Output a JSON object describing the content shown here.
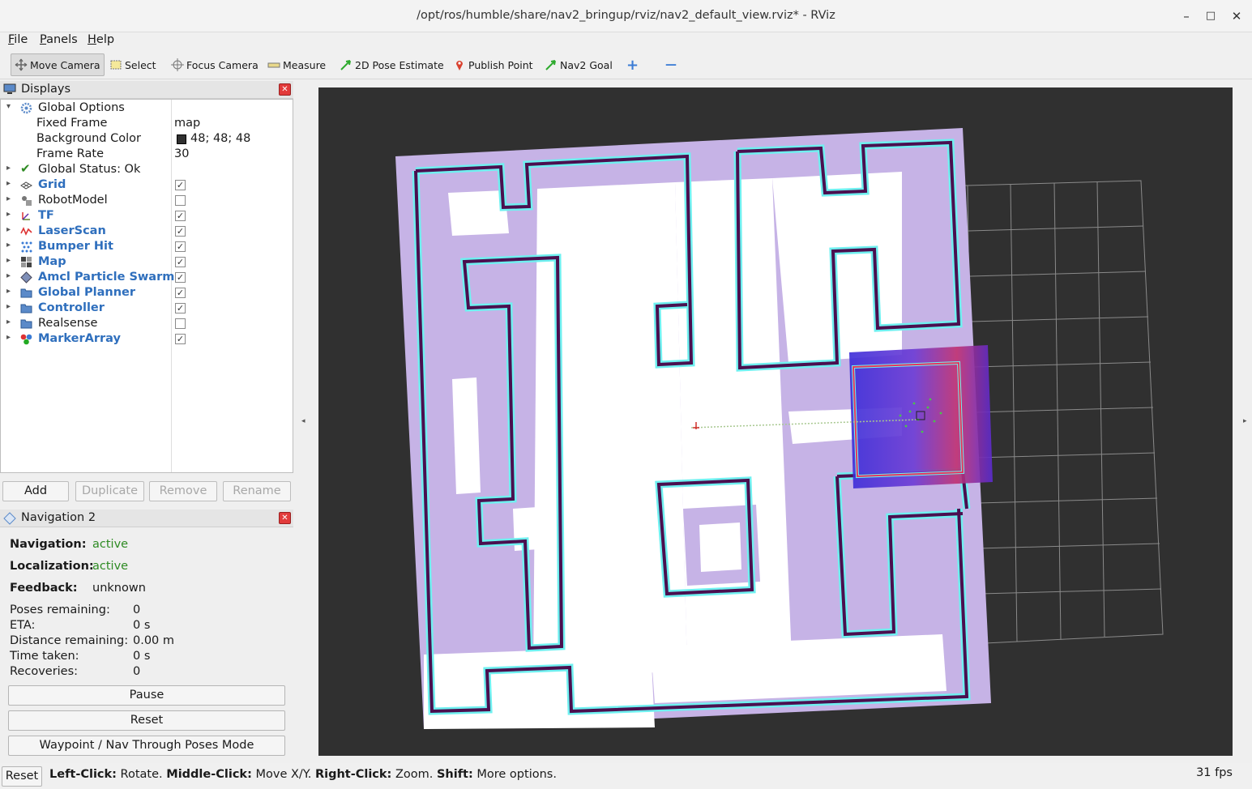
{
  "window": {
    "title": "/opt/ros/humble/share/nav2_bringup/rviz/nav2_default_view.rviz* - RViz",
    "minimize": "–",
    "maximize": "□",
    "close": "✕"
  },
  "menu": {
    "file": "File",
    "panels": "Panels",
    "help": "Help"
  },
  "toolbar": {
    "move_camera": "Move Camera",
    "select": "Select",
    "focus_camera": "Focus Camera",
    "measure": "Measure",
    "pose_estimate": "2D Pose Estimate",
    "publish_point": "Publish Point",
    "nav2_goal": "Nav2 Goal",
    "add_tool": "+",
    "remove_tool": "—"
  },
  "displays": {
    "title": "Displays",
    "close": "✕",
    "global_options": "Global Options",
    "fixed_frame_label": "Fixed Frame",
    "fixed_frame_value": "map",
    "bg_color_label": "Background Color",
    "bg_color_value": "48; 48; 48",
    "bg_color_hex": "#303030",
    "frame_rate_label": "Frame Rate",
    "frame_rate_value": "30",
    "global_status": "Global Status: Ok",
    "items": [
      {
        "label": "Grid",
        "checked": true,
        "bold": true,
        "icon": "grid-icon"
      },
      {
        "label": "RobotModel",
        "checked": false,
        "bold": false,
        "icon": "robot-model-icon"
      },
      {
        "label": "TF",
        "checked": true,
        "bold": true,
        "icon": "tf-icon"
      },
      {
        "label": "LaserScan",
        "checked": true,
        "bold": true,
        "icon": "laser-scan-icon"
      },
      {
        "label": "Bumper Hit",
        "checked": true,
        "bold": true,
        "icon": "bumper-hit-icon"
      },
      {
        "label": "Map",
        "checked": true,
        "bold": true,
        "icon": "map-icon"
      },
      {
        "label": "Amcl Particle Swarm",
        "checked": true,
        "bold": true,
        "icon": "particle-swarm-icon"
      },
      {
        "label": "Global Planner",
        "checked": true,
        "bold": true,
        "icon": "folder-icon"
      },
      {
        "label": "Controller",
        "checked": true,
        "bold": true,
        "icon": "folder-icon"
      },
      {
        "label": "Realsense",
        "checked": false,
        "bold": false,
        "icon": "folder-icon"
      },
      {
        "label": "MarkerArray",
        "checked": true,
        "bold": true,
        "icon": "marker-array-icon"
      }
    ],
    "buttons": {
      "add": "Add",
      "duplicate": "Duplicate",
      "remove": "Remove",
      "rename": "Rename"
    }
  },
  "navigation": {
    "title": "Navigation 2",
    "close": "✕",
    "navigation_label": "Navigation:",
    "navigation_value": "active",
    "localization_label": "Localization:",
    "localization_value": "active",
    "feedback_label": "Feedback:",
    "feedback_value": "unknown",
    "poses_label": "Poses remaining:",
    "poses_value": "0",
    "eta_label": "ETA:",
    "eta_value": "0 s",
    "distance_label": "Distance remaining:",
    "distance_value": "0.00 m",
    "time_label": "Time taken:",
    "time_value": "0 s",
    "recoveries_label": "Recoveries:",
    "recoveries_value": "0",
    "pause": "Pause",
    "reset": "Reset",
    "waypoint_mode": "Waypoint / Nav Through Poses Mode"
  },
  "status": {
    "reset": "Reset",
    "left_click_key": "Left-Click:",
    "left_click_val": " Rotate. ",
    "middle_click_key": "Middle-Click:",
    "middle_click_val": " Move X/Y. ",
    "right_click_key": "Right-Click:",
    "right_click_val": " Zoom. ",
    "shift_key": "Shift:",
    "shift_val": " More options.",
    "fps": "31 fps"
  },
  "colors": {
    "accent_blue": "#2f6fbd",
    "active_green": "#2e8b23",
    "costmap_lavender": "#c6b3e6",
    "inflation_cyan": "#6ff0f0"
  }
}
